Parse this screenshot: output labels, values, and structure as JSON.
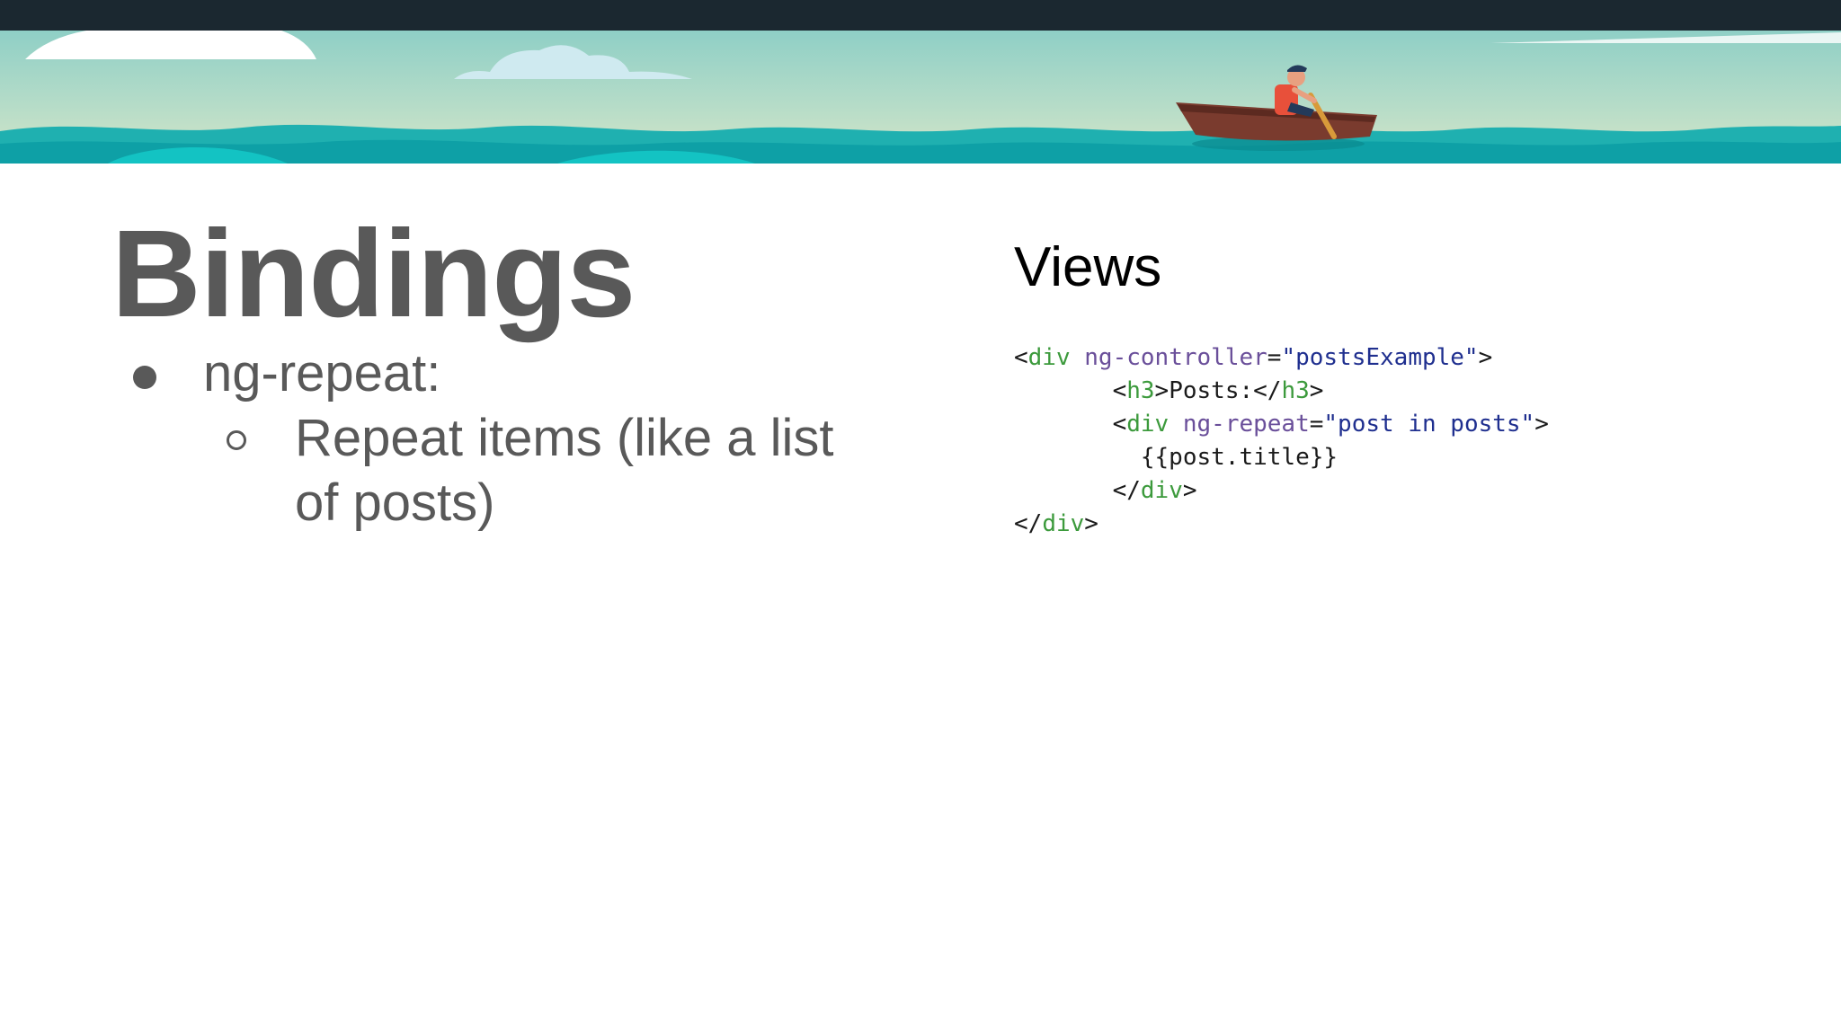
{
  "slide": {
    "title": "Bindings",
    "bullet_1": "ng-repeat:",
    "bullet_1_sub": "Repeat items (like a list of posts)"
  },
  "views": {
    "heading": "Views",
    "code_lines": [
      [
        {
          "t": "<",
          "k": "punc"
        },
        {
          "t": "div",
          "k": "tag"
        },
        {
          "t": " ",
          "k": "punc"
        },
        {
          "t": "ng-controller",
          "k": "attr"
        },
        {
          "t": "=",
          "k": "punc"
        },
        {
          "t": "\"postsExample\"",
          "k": "str"
        },
        {
          "t": ">",
          "k": "punc"
        }
      ],
      [
        {
          "t": "       <",
          "k": "punc"
        },
        {
          "t": "h3",
          "k": "tag"
        },
        {
          "t": ">Posts:</",
          "k": "punc"
        },
        {
          "t": "h3",
          "k": "tag"
        },
        {
          "t": ">",
          "k": "punc"
        }
      ],
      [
        {
          "t": "       <",
          "k": "punc"
        },
        {
          "t": "div",
          "k": "tag"
        },
        {
          "t": " ",
          "k": "punc"
        },
        {
          "t": "ng-repeat",
          "k": "attr"
        },
        {
          "t": "=",
          "k": "punc"
        },
        {
          "t": "\"post in posts\"",
          "k": "str"
        },
        {
          "t": ">",
          "k": "punc"
        }
      ],
      [
        {
          "t": "         {{post.title}}",
          "k": "punc"
        }
      ],
      [
        {
          "t": "       </",
          "k": "punc"
        },
        {
          "t": "div",
          "k": "tag"
        },
        {
          "t": ">",
          "k": "punc"
        }
      ],
      [
        {
          "t": "</",
          "k": "punc"
        },
        {
          "t": "div",
          "k": "tag"
        },
        {
          "t": ">",
          "k": "punc"
        }
      ]
    ]
  },
  "colors": {
    "topbar": "#1b2830",
    "title_text": "#595959",
    "code_tag": "#3c9a3c",
    "code_attr": "#6a4f9a",
    "code_string": "#1f2f8f"
  }
}
